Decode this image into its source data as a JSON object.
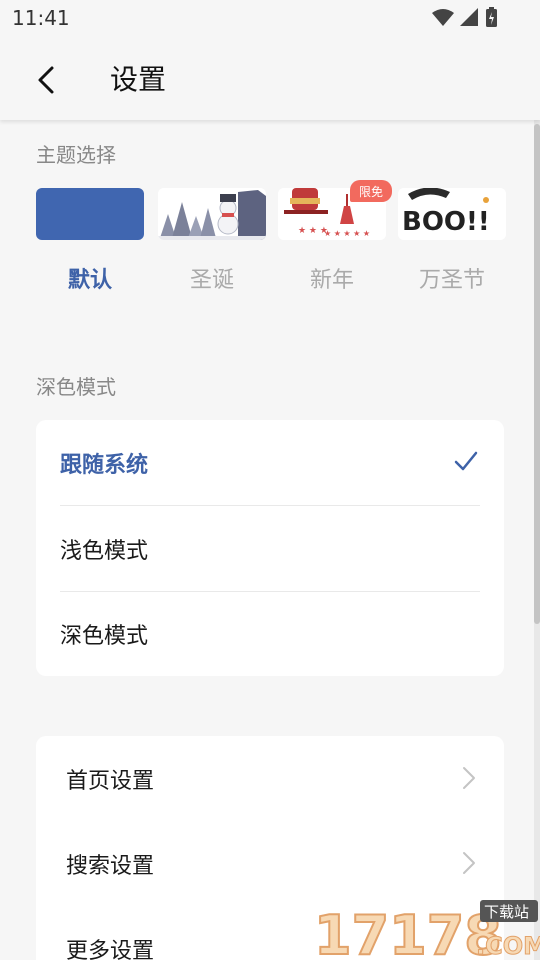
{
  "status_bar": {
    "time": "11:41"
  },
  "app_bar": {
    "title": "设置"
  },
  "theme_section": {
    "label": "主题选择",
    "badge": "限免",
    "themes": [
      {
        "name": "默认",
        "selected": true
      },
      {
        "name": "圣诞",
        "selected": false
      },
      {
        "name": "新年",
        "selected": false
      },
      {
        "name": "万圣节",
        "selected": false
      }
    ],
    "halloween_art_text": "BOO!!"
  },
  "dark_mode_section": {
    "label": "深色模式",
    "options": [
      {
        "label": "跟随系统",
        "selected": true
      },
      {
        "label": "浅色模式",
        "selected": false
      },
      {
        "label": "深色模式",
        "selected": false
      }
    ]
  },
  "settings_list": {
    "items": [
      {
        "label": "首页设置"
      },
      {
        "label": "搜索设置"
      },
      {
        "label": "更多设置"
      }
    ]
  },
  "watermark": {
    "number": "17178",
    "domain": ".COM",
    "tag": "下载站"
  },
  "colors": {
    "accent": "#3e62a8",
    "default_theme_swatch": "#4066b0",
    "badge": "#f26a5e",
    "background": "#f6f6f6",
    "card": "#ffffff"
  }
}
